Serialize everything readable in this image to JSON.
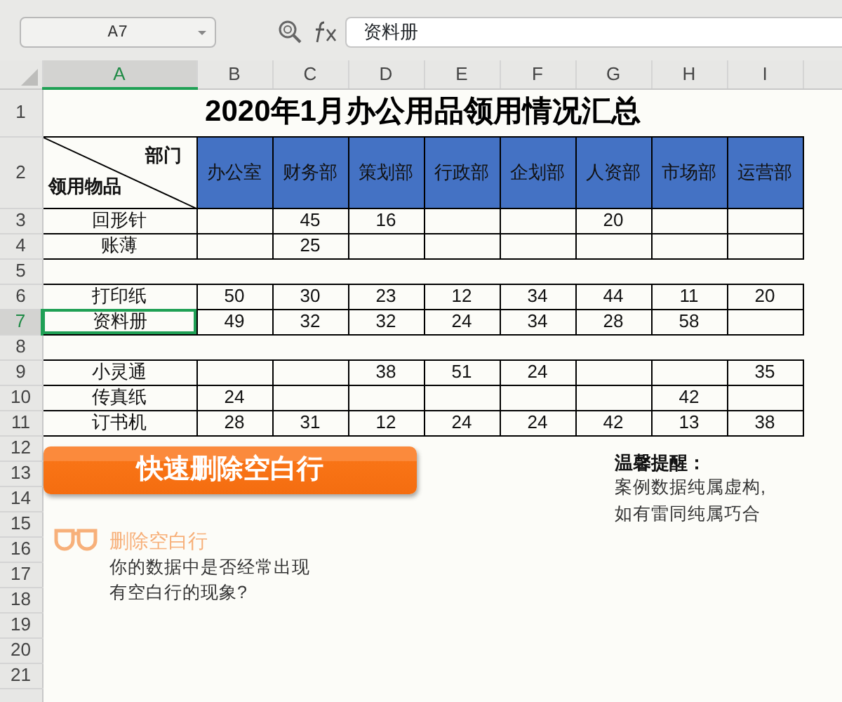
{
  "name_box": "A7",
  "formula_bar": {
    "value": "资料册"
  },
  "column_headers": [
    {
      "label": "A",
      "selected": true
    },
    {
      "label": "B",
      "selected": false
    },
    {
      "label": "C",
      "selected": false
    },
    {
      "label": "D",
      "selected": false
    },
    {
      "label": "E",
      "selected": false
    },
    {
      "label": "F",
      "selected": false
    },
    {
      "label": "G",
      "selected": false
    },
    {
      "label": "H",
      "selected": false
    },
    {
      "label": "I",
      "selected": false
    }
  ],
  "title": {
    "row": "1",
    "text": "2020年1月办公用品领用情况汇总"
  },
  "header": {
    "row": "2",
    "corner_top": "部门",
    "corner_bottom": "领用物品",
    "departments": [
      "办公室",
      "财务部",
      "策划部",
      "行政部",
      "企划部",
      "人资部",
      "市场部",
      "运营部"
    ]
  },
  "rows": [
    {
      "row": "3",
      "kind": "data",
      "selected": false,
      "item": "回形针",
      "cells": {
        "C": "45",
        "D": "16",
        "G": "20"
      }
    },
    {
      "row": "4",
      "kind": "data",
      "selected": false,
      "item": "账薄",
      "cells": {
        "C": "25"
      }
    },
    {
      "row": "5",
      "kind": "blank",
      "selected": false
    },
    {
      "row": "6",
      "kind": "data",
      "selected": false,
      "item": "打印纸",
      "cells": {
        "B": "50",
        "C": "30",
        "D": "23",
        "E": "12",
        "F": "34",
        "G": "44",
        "H": "11",
        "I": "20"
      }
    },
    {
      "row": "7",
      "kind": "data",
      "selected": true,
      "item": "资料册",
      "cells": {
        "B": "49",
        "C": "32",
        "D": "32",
        "E": "24",
        "F": "34",
        "G": "28",
        "H": "58"
      }
    },
    {
      "row": "8",
      "kind": "blank",
      "selected": false
    },
    {
      "row": "9",
      "kind": "data",
      "selected": false,
      "item": "小灵通",
      "cells": {
        "D": "38",
        "E": "51",
        "F": "24",
        "I": "35"
      }
    },
    {
      "row": "10",
      "kind": "data",
      "selected": false,
      "item": "传真纸",
      "cells": {
        "B": "24",
        "H": "42"
      }
    },
    {
      "row": "11",
      "kind": "data",
      "selected": false,
      "item": "订书机",
      "cells": {
        "B": "28",
        "C": "31",
        "D": "12",
        "E": "24",
        "F": "24",
        "G": "42",
        "H": "13",
        "I": "38"
      }
    },
    {
      "row": "12",
      "kind": "empty",
      "selected": false
    },
    {
      "row": "13",
      "kind": "empty",
      "selected": false
    },
    {
      "row": "14",
      "kind": "empty",
      "selected": false
    },
    {
      "row": "15",
      "kind": "empty",
      "selected": false
    },
    {
      "row": "16",
      "kind": "empty",
      "selected": false
    },
    {
      "row": "17",
      "kind": "empty",
      "selected": false
    },
    {
      "row": "18",
      "kind": "empty",
      "selected": false
    },
    {
      "row": "19",
      "kind": "empty",
      "selected": false
    },
    {
      "row": "20",
      "kind": "empty",
      "selected": false
    },
    {
      "row": "21",
      "kind": "empty",
      "selected": false
    }
  ],
  "banner": {
    "text": "快速删除空白行"
  },
  "tip": {
    "title": "删除空白行",
    "lines": [
      "你的数据中是否经常出现",
      "有空白行的现象?"
    ]
  },
  "note": {
    "title": "温馨提醒：",
    "lines": [
      "案例数据纯属虚构,",
      "如有雷同纯属巧合"
    ]
  }
}
